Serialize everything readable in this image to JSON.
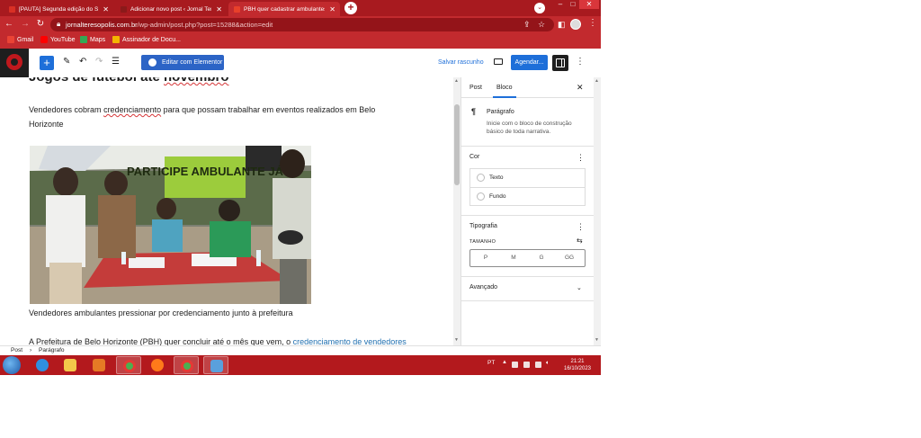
{
  "browser": {
    "tabs": [
      {
        "title": "[PAUTA] Segunda edição do Sext",
        "favicon_color": "#d93025"
      },
      {
        "title": "Adicionar novo post ‹ Jornal Tere",
        "favicon_color": "#8b1a1a"
      },
      {
        "title": "PBH quer cadastrar ambulantes p",
        "favicon_color": "#e8402a"
      }
    ],
    "url_host": "jornalteresopolis.com.br",
    "url_path": "/wp-admin/post.php?post=15288&action=edit",
    "bookmarks": [
      {
        "label": "Gmail",
        "icon_color": "#ea4335"
      },
      {
        "label": "YouTube",
        "icon_color": "#ff0000"
      },
      {
        "label": "Maps",
        "icon_color": "#34a853"
      },
      {
        "label": "Assinador de Docu...",
        "icon_color": "#f4b400"
      }
    ]
  },
  "wp_toolbar": {
    "elementor_label": "Editar com Elementor",
    "save_draft": "Salvar rascunho",
    "schedule": "Agendar..."
  },
  "editor": {
    "title_start": "Jogos de futebol até ",
    "title_underlined": "novembro",
    "paragraph1_pre": "Vendedores cobram ",
    "paragraph1_misspelled": "credenciamento",
    "paragraph1_post": " para que possam trabalhar em eventos realizados em Belo Horizonte",
    "banner_text": "PARTICIPE AMBULANTE JÁ",
    "caption": "Vendedores ambulantes pressionar por credenciamento junto à prefeitura",
    "paragraph2_pre": "A Prefeitura de Belo Horizonte (PBH) quer concluir até o mês que vem, o ",
    "paragraph2_link": "credenciamento de vendedores"
  },
  "sidebar": {
    "tab_post": "Post",
    "tab_block": "Bloco",
    "block_icon": "¶",
    "block_name": "Parágrafo",
    "block_desc": "Inicie com o bloco de construção básico de toda narrativa.",
    "color_heading": "Cor",
    "color_text": "Texto",
    "color_background": "Fundo",
    "typography_heading": "Tipografia",
    "size_label": "TAMANHO",
    "sizes": [
      "P",
      "M",
      "G",
      "GG"
    ],
    "advanced_heading": "Avançado"
  },
  "breadcrumb": [
    "Post",
    "Parágrafo"
  ],
  "taskbar": {
    "language": "PT",
    "time": "21:21",
    "date": "16/10/2023"
  },
  "colors": {
    "browser_chrome": "#c22a2e",
    "wp_blue": "#1e6fd9",
    "taskbar": "#b3191d",
    "banner_green": "#9ccc3c"
  }
}
